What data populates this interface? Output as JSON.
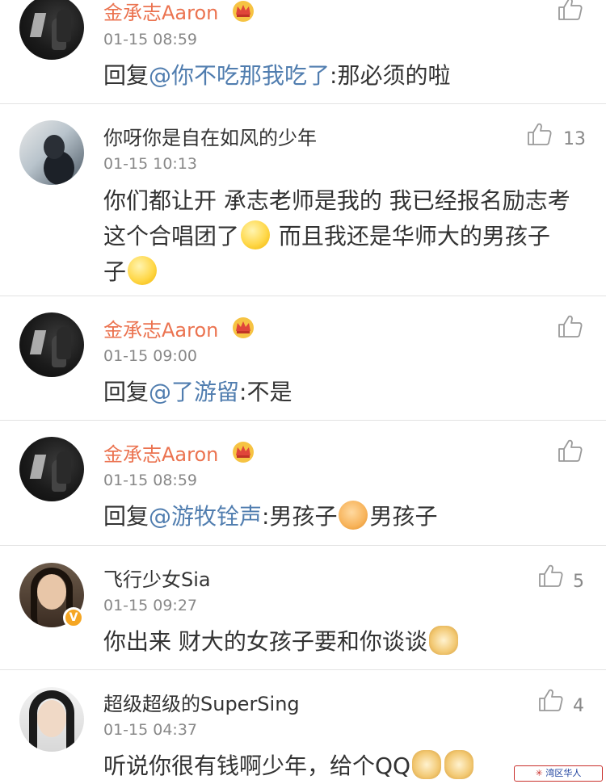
{
  "comments": [
    {
      "name": "金承志Aaron",
      "time": "01-15 08:59",
      "reply_prefix": "回复",
      "mention": "@你不吃那我吃了",
      "text": ":那必须的啦",
      "likes": ""
    },
    {
      "name": "你呀你是自在如风的少年",
      "time": "01-15 10:13",
      "text_parts": [
        "你们都让开 承志老师是我的 我已经报名励志考这个合唱团了",
        " 而且我还是华师大的男孩子",
        ""
      ],
      "likes": "13"
    },
    {
      "name": "金承志Aaron",
      "time": "01-15 09:00",
      "reply_prefix": "回复",
      "mention": "@了游留",
      "text": ":不是",
      "likes": ""
    },
    {
      "name": "金承志Aaron",
      "time": "01-15 08:59",
      "reply_prefix": "回复",
      "mention": "@游牧铨声",
      "text": ":男孩子",
      "text_after": "男孩子",
      "likes": ""
    },
    {
      "name": "飞行少女Sia",
      "time": "01-15 09:27",
      "text": "你出来 财大的女孩子要和你谈谈",
      "likes": "5",
      "verified_badge": "V"
    },
    {
      "name": "超级超级的SuperSing",
      "time": "01-15 04:37",
      "text": "听说你很有钱啊少年，给个QQ",
      "likes": "4"
    }
  ],
  "watermark": {
    "star": "✳",
    "text": "湾区华人"
  },
  "icons": {
    "like": "thumb-up-icon",
    "crown": "crown-badge-icon",
    "verified": "verified-v-icon"
  },
  "colors": {
    "vip_name": "#eb7350",
    "mention": "#507daf",
    "meta": "#888888",
    "divider": "#e3e3e3"
  }
}
